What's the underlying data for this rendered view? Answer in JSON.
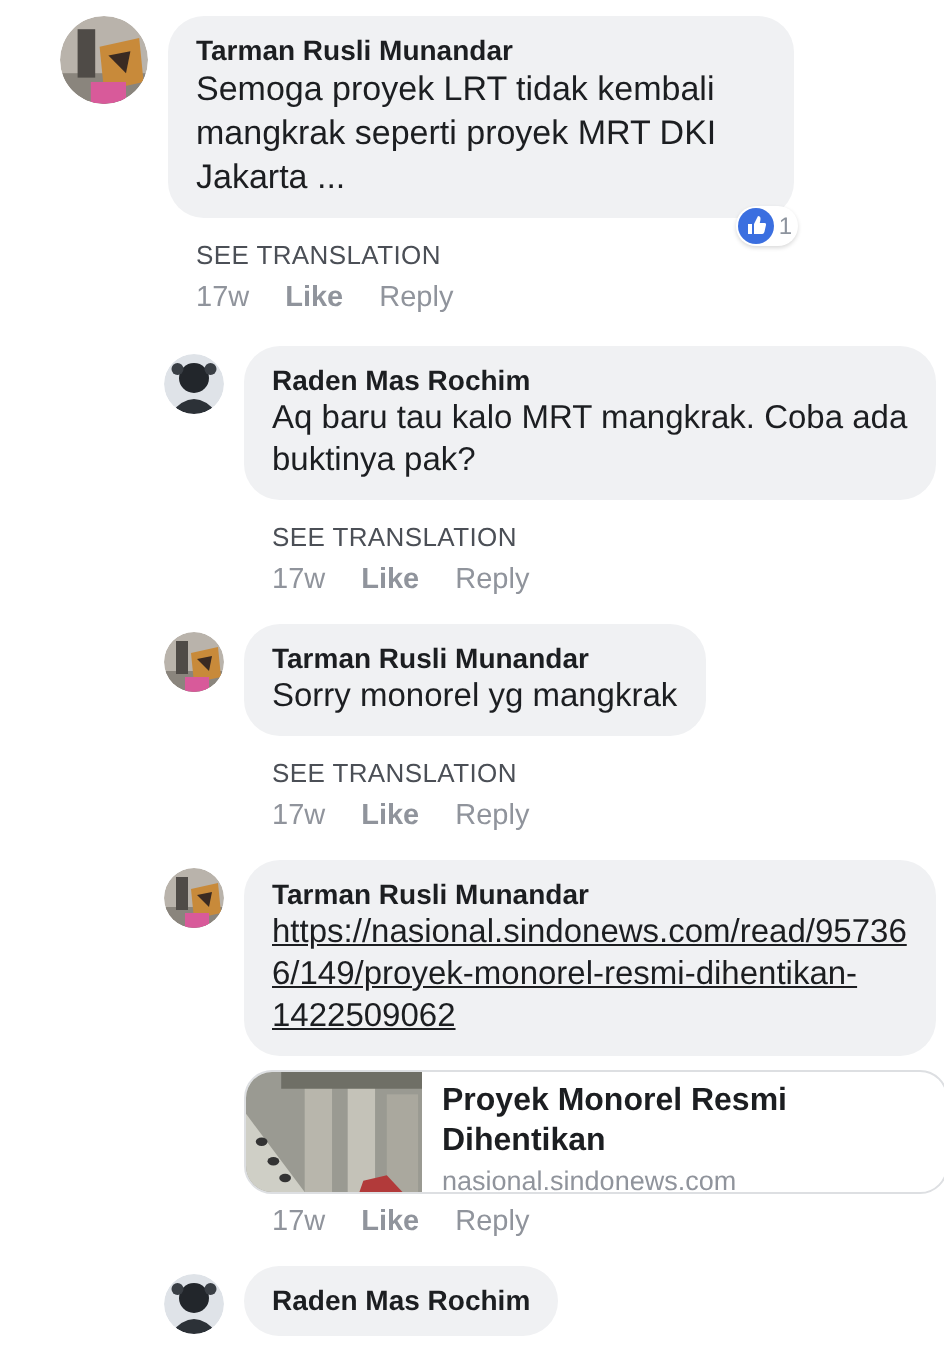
{
  "comments": [
    {
      "author": "Tarman Rusli Munandar",
      "text": "Semoga proyek LRT  tidak kembali mangkrak seperti proyek MRT DKI Jakarta ...",
      "reactions": {
        "count": "1"
      },
      "see_translation": "SEE TRANSLATION",
      "time": "17w",
      "like": "Like",
      "reply": "Reply",
      "children": [
        {
          "author": "Raden Mas Rochim",
          "text": "Aq baru tau kalo MRT mangkrak. Coba ada buktinya pak?",
          "see_translation": "SEE TRANSLATION",
          "time": "17w",
          "like": "Like",
          "reply": "Reply"
        },
        {
          "author": "Tarman Rusli Munandar",
          "text": "Sorry monorel yg mangkrak",
          "see_translation": "SEE TRANSLATION",
          "time": "17w",
          "like": "Like",
          "reply": "Reply"
        },
        {
          "author": "Tarman Rusli Munandar",
          "link": "https://nasional.sindonews.com/read/957366/149/proyek-monorel-resmi-dihentikan-1422509062",
          "preview": {
            "kind": "picture",
            "title": "Proyek Monorel Resmi Dihentikan",
            "domain": "nasional.sindonews.com"
          },
          "time": "17w",
          "like": "Like",
          "reply": "Reply"
        },
        {
          "author": "Raden Mas Rochim"
        }
      ]
    }
  ]
}
